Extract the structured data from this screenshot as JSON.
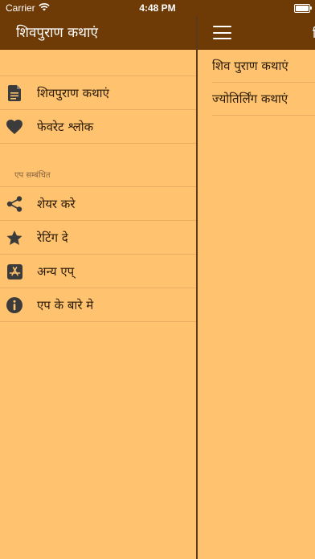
{
  "status_bar": {
    "carrier": "Carrier",
    "time": "4:48 PM"
  },
  "drawer": {
    "title": "शिवपुराण कथाएं",
    "items": [
      {
        "icon": "document-icon",
        "label": "शिवपुराण कथाएं"
      },
      {
        "icon": "heart-icon",
        "label": "फेवरेट श्लोक"
      }
    ],
    "section_title": "एप सम्बंधित",
    "section_items": [
      {
        "icon": "share-icon",
        "label": "शेयर करे"
      },
      {
        "icon": "star-icon",
        "label": "रेटिंग दे"
      },
      {
        "icon": "app-store-icon",
        "label": "अन्य एप्"
      },
      {
        "icon": "info-icon",
        "label": "एप के बारे मे"
      }
    ]
  },
  "main": {
    "title_peek": "ि",
    "items": [
      {
        "label": "शिव पुराण कथाएं"
      },
      {
        "label": "ज्योतिर्लिंग कथाएं"
      }
    ]
  },
  "colors": {
    "header_brown": "#6E3A06",
    "background_orange": "#FFC36F",
    "icon_dark": "#3b3b3b"
  }
}
